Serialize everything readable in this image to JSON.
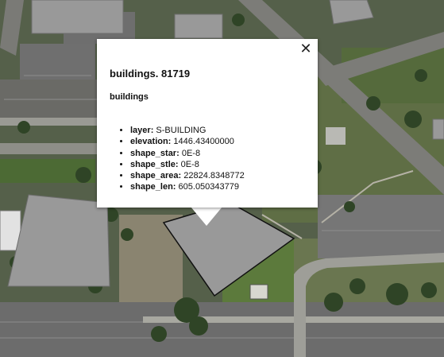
{
  "map": {
    "layer_style": {
      "building_fill": "#999999",
      "building_stroke": "#6e6e6e",
      "highlight_stroke": "#111111"
    }
  },
  "popup": {
    "close_icon": "close-icon",
    "title": "buildings. 81719",
    "layer_name": "buildings",
    "attributes": [
      {
        "key": "layer:",
        "value": "S-BUILDING"
      },
      {
        "key": "elevation:",
        "value": "1446.43400000"
      },
      {
        "key": "shape_star:",
        "value": "0E-8"
      },
      {
        "key": "shape_stle:",
        "value": "0E-8"
      },
      {
        "key": "shape_area:",
        "value": "22824.8348772"
      },
      {
        "key": "shape_len:",
        "value": "605.050343779"
      }
    ]
  }
}
